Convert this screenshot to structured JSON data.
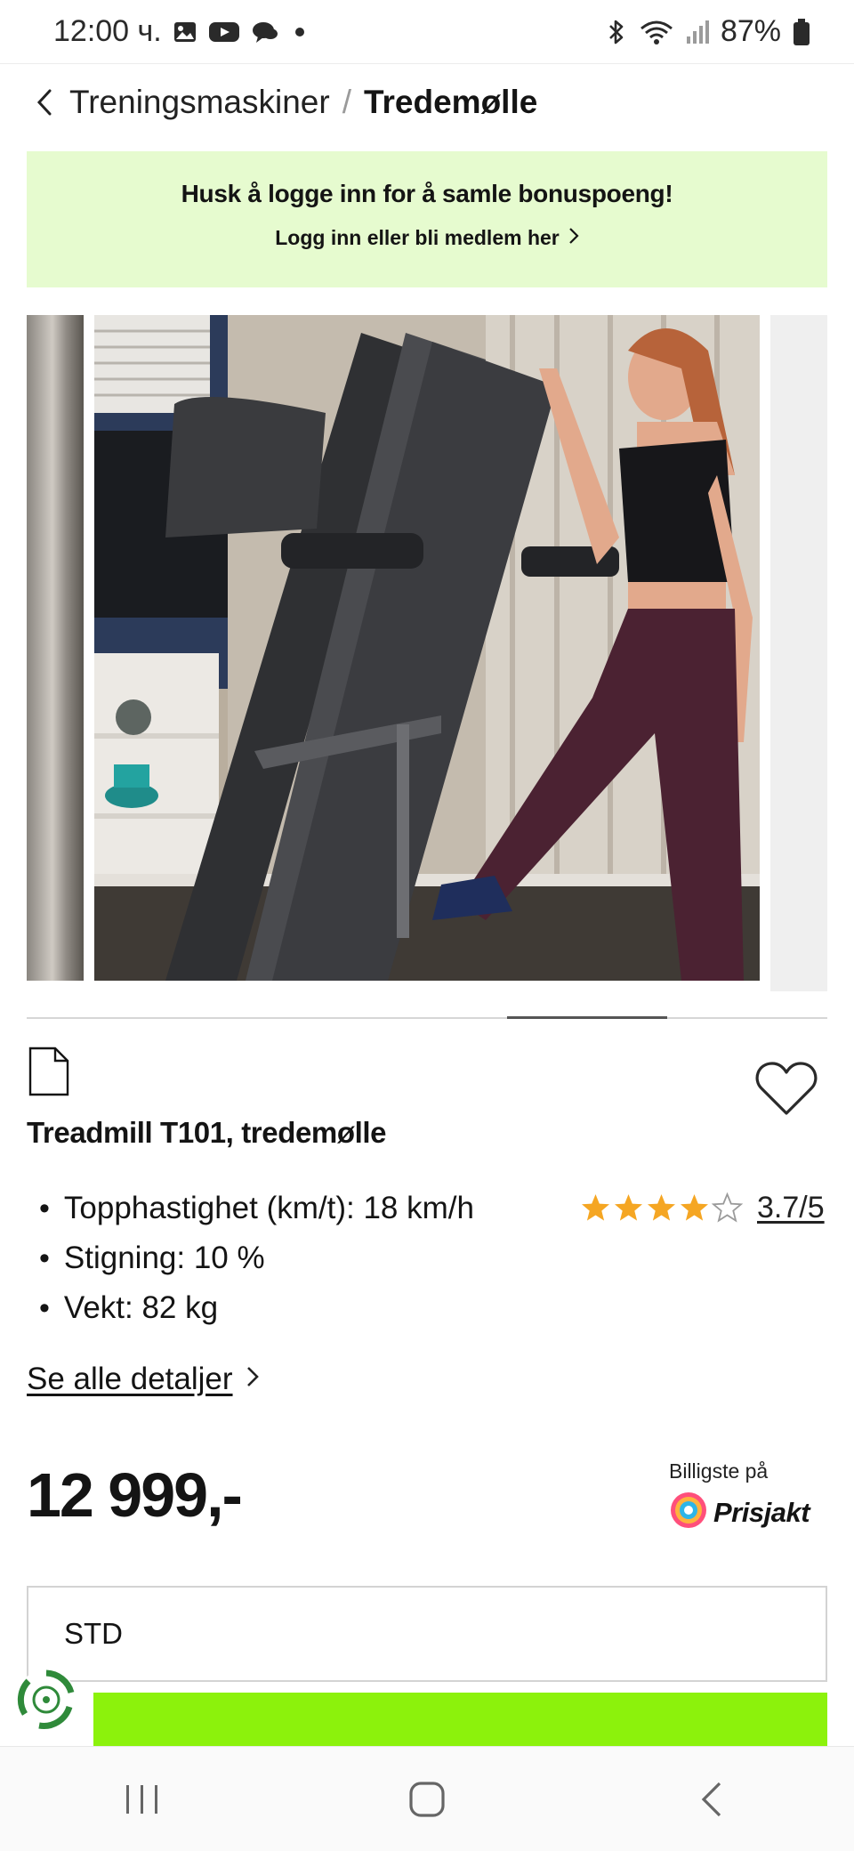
{
  "status_bar": {
    "time": "12:00 ч.",
    "battery": "87%",
    "icons": [
      "gallery-icon",
      "youtube-icon",
      "chat-icon",
      "dot-icon",
      "bluetooth-icon",
      "wifi-icon",
      "signal-icon",
      "battery-icon"
    ]
  },
  "breadcrumb": {
    "parent": "Treningsmaskiner",
    "separator": "/",
    "current": "Tredemølle"
  },
  "promo": {
    "title": "Husk å logge inn for å samle bonuspoeng!",
    "link": "Logg inn eller bli medlem her",
    "background": "#e6fbcf"
  },
  "gallery": {
    "images": [
      "window-curtain-thumbnail",
      "woman-folding-treadmill-photo",
      "next-image-placeholder"
    ],
    "progress": 0.2
  },
  "product": {
    "title": "Treadmill T101, tredemølle",
    "specs": [
      "Topphastighet (km/t): 18 km/h",
      "Stigning: 10 %",
      "Vekt: 82 kg"
    ],
    "rating": {
      "value": 3.7,
      "max": 5,
      "text": "3.7/5",
      "star_color": "#f5a623"
    },
    "details_link": "Se alle detaljer",
    "price": "12 999,-",
    "prisjakt_caption": "Billigste på",
    "prisjakt_name": "Prisjakt",
    "variant": "STD"
  },
  "cta": {
    "color": "#8cf20c"
  },
  "nav": {
    "buttons": [
      "recent-apps-icon",
      "home-icon",
      "back-icon"
    ]
  }
}
